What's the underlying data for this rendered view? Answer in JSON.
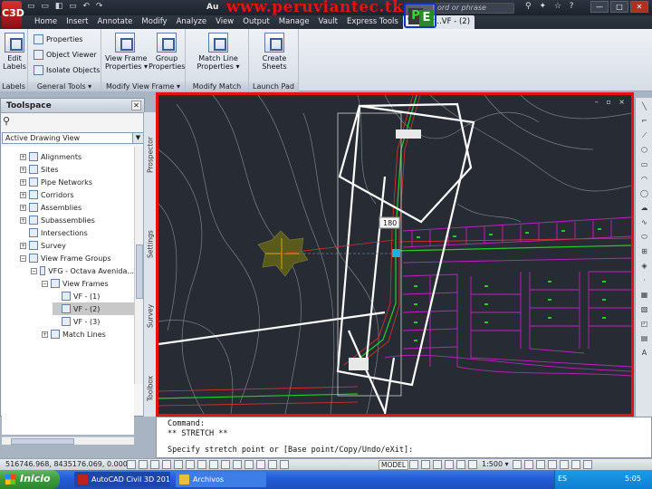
{
  "app": {
    "window_title": "Au",
    "watermark": "www.peruviantec.tk",
    "logo_text": "C3D",
    "search_placeholder": "ord or phrase",
    "window_controls": [
      "—",
      "□",
      "✕"
    ]
  },
  "ribbon_tabs": [
    {
      "label": "Home",
      "active": false
    },
    {
      "label": "Insert",
      "active": false
    },
    {
      "label": "Annotate",
      "active": false
    },
    {
      "label": "Modify",
      "active": false
    },
    {
      "label": "Analyze",
      "active": false
    },
    {
      "label": "View",
      "active": false
    },
    {
      "label": "Output",
      "active": false
    },
    {
      "label": "Manage",
      "active": false
    },
    {
      "label": "Vault",
      "active": false
    },
    {
      "label": "Express Tools",
      "active": false
    },
    {
      "label": "View Fr...VF - (2)",
      "active": true
    }
  ],
  "ribbon": {
    "labels_group": {
      "title": "Labels",
      "edit_labels": "Edit\nLabels"
    },
    "general_tools": {
      "title": "General Tools ▾",
      "properties": "Properties",
      "object_viewer": "Object Viewer",
      "isolate_objects": "Isolate Objects"
    },
    "modify_view_frame": {
      "title": "Modify View Frame ▾",
      "view_frame_properties": "View Frame\nProperties ▾",
      "group_properties": "Group\nProperties"
    },
    "modify_match_line": {
      "title": "Modify Match Line",
      "match_line_properties": "Match Line\nProperties ▾"
    },
    "launch_pad": {
      "title": "Launch Pad",
      "create_sheets": "Create Sheets"
    }
  },
  "toolspace": {
    "title": "Toolspace",
    "view_combo": "Active Drawing View",
    "side_tabs": [
      "Prospector",
      "Settings",
      "Survey",
      "Toolbox"
    ],
    "tree": [
      {
        "label": "Alignments",
        "level": 0,
        "exp": "+",
        "selected": false
      },
      {
        "label": "Sites",
        "level": 0,
        "exp": "+",
        "selected": false
      },
      {
        "label": "Pipe Networks",
        "level": 0,
        "exp": "+",
        "selected": false
      },
      {
        "label": "Corridors",
        "level": 0,
        "exp": "+",
        "selected": false
      },
      {
        "label": "Assemblies",
        "level": 0,
        "exp": "+",
        "selected": false
      },
      {
        "label": "Subassemblies",
        "level": 0,
        "exp": "+",
        "selected": false
      },
      {
        "label": "Intersections",
        "level": 0,
        "exp": "",
        "selected": false
      },
      {
        "label": "Survey",
        "level": 0,
        "exp": "+",
        "selected": false
      },
      {
        "label": "View Frame Groups",
        "level": 0,
        "exp": "−",
        "selected": false
      },
      {
        "label": "VFG - Octava Avenida...",
        "level": 1,
        "exp": "−",
        "selected": false
      },
      {
        "label": "View Frames",
        "level": 2,
        "exp": "−",
        "selected": false
      },
      {
        "label": "VF - (1)",
        "level": 3,
        "exp": "",
        "selected": false
      },
      {
        "label": "VF - (2)",
        "level": 3,
        "exp": "",
        "selected": true
      },
      {
        "label": "VF - (3)",
        "level": 3,
        "exp": "",
        "selected": false
      },
      {
        "label": "Match Lines",
        "level": 2,
        "exp": "+",
        "selected": false
      }
    ]
  },
  "viewport": {
    "controls": "– ▫ ×",
    "station_label": "180"
  },
  "command_line": [
    "Command:",
    "** STRETCH **",
    "Specify stretch point or [Base point/Copy/Undo/eXit]:"
  ],
  "statusbar": {
    "coords": "516746.968, 8435176.069, 0.000",
    "model": "MODEL",
    "scale": "1:500 ▾"
  },
  "taskbar": {
    "start": "Inicio",
    "tasks": [
      {
        "label": "AutoCAD Civil 3D 201...",
        "active": true
      },
      {
        "label": "Archivos",
        "active": false
      }
    ],
    "lang": "ES",
    "clock": "5:05"
  },
  "colors": {
    "highlight_frame": "#e81010",
    "logo_frame": "#1030d0",
    "drawing_bg": "#272c34",
    "parcels": "#c020c0",
    "alignment": "#20d020"
  }
}
